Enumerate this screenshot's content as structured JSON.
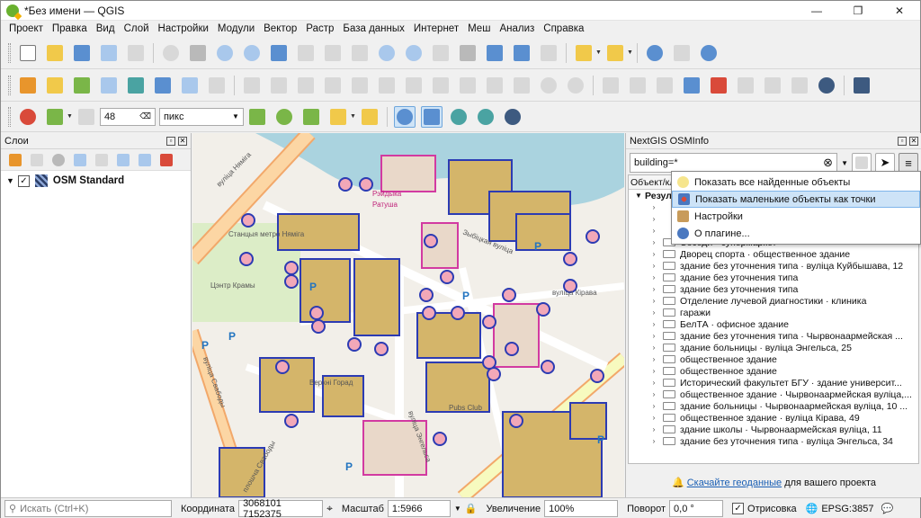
{
  "window": {
    "title": "*Без имени — QGIS",
    "controls": [
      "—",
      "❐",
      "✕"
    ]
  },
  "menubar": [
    "Проект",
    "Правка",
    "Вид",
    "Слой",
    "Настройки",
    "Модули",
    "Вектор",
    "Растр",
    "База данных",
    "Интернет",
    "Меш",
    "Анализ",
    "Справка"
  ],
  "toolbar3": {
    "snap_value": "48",
    "unit": "пикс"
  },
  "layers_panel": {
    "title": "Слои",
    "layer": {
      "name": "OSM Standard",
      "checked": "✓",
      "expand": "▼"
    }
  },
  "map_labels": {
    "street1": "вуліца Няміга",
    "street2": "Зыбіцкая вуліца",
    "street3": "вуліца Энгельса",
    "street4": "вуліца Кірава",
    "street5": "вуліца Свабоды",
    "park": "Цэнтр Крамы",
    "square": "плошча Свабоды",
    "market": "Ратуша",
    "station": "Станцыя метро Няміга",
    "rest1": "Pubs Club",
    "rest2": "Рэйдыка",
    "rest3": "Верхні Горад"
  },
  "osm_panel": {
    "title": "NextGIS OSMInfo",
    "query": "building=*",
    "clear": "⊗",
    "column_header": "Объект/кл",
    "root_label": "Резул",
    "items": [
      "Соседи · супермаркет",
      "Дворец спорта · общественное здание",
      "здание без уточнения типа · вуліца Куйбышава, 12",
      "здание без уточнения типа",
      "здание без уточнения типа",
      "Отделение лучевой диагностики · клиника",
      "гаражи",
      "БелТА · офисное здание",
      "здание без уточнения типа · Чырвонаармейская ...",
      "здание больницы · вуліца Энгельса, 25",
      "общественное здание",
      "общественное здание",
      "Исторический факультет БГУ · здание университ...",
      "общественное здание · Чырвонаармейская вуліца,...",
      "здание больницы · Чырвонаармейская вуліца, 10 ...",
      "общественное здание · вуліца Кірава, 49",
      "здание школы · Чырвонаармейская вуліца, 11",
      "здание без уточнения типа · вуліца Энгельса, 34"
    ],
    "footer_link": "Скачайте геоданные",
    "footer_text": " для вашего проекта"
  },
  "popup_menu": [
    "Показать все найденные объекты",
    "Показать маленькие объекты как точки",
    "Настройки",
    "О плагине..."
  ],
  "statusbar": {
    "search_placeholder": "Искать (Ctrl+K)",
    "coord_label": "Координата",
    "coord_value": "3068101  7152375",
    "scale_label": "Масштаб",
    "scale_value": "1:5966",
    "zoom_label": "Увеличение",
    "zoom_value": "100%",
    "rotation_label": "Поворот",
    "rotation_value": "0,0 °",
    "render_label": "Отрисовка",
    "render_checked": "✓",
    "crs": "EPSG:3857"
  }
}
